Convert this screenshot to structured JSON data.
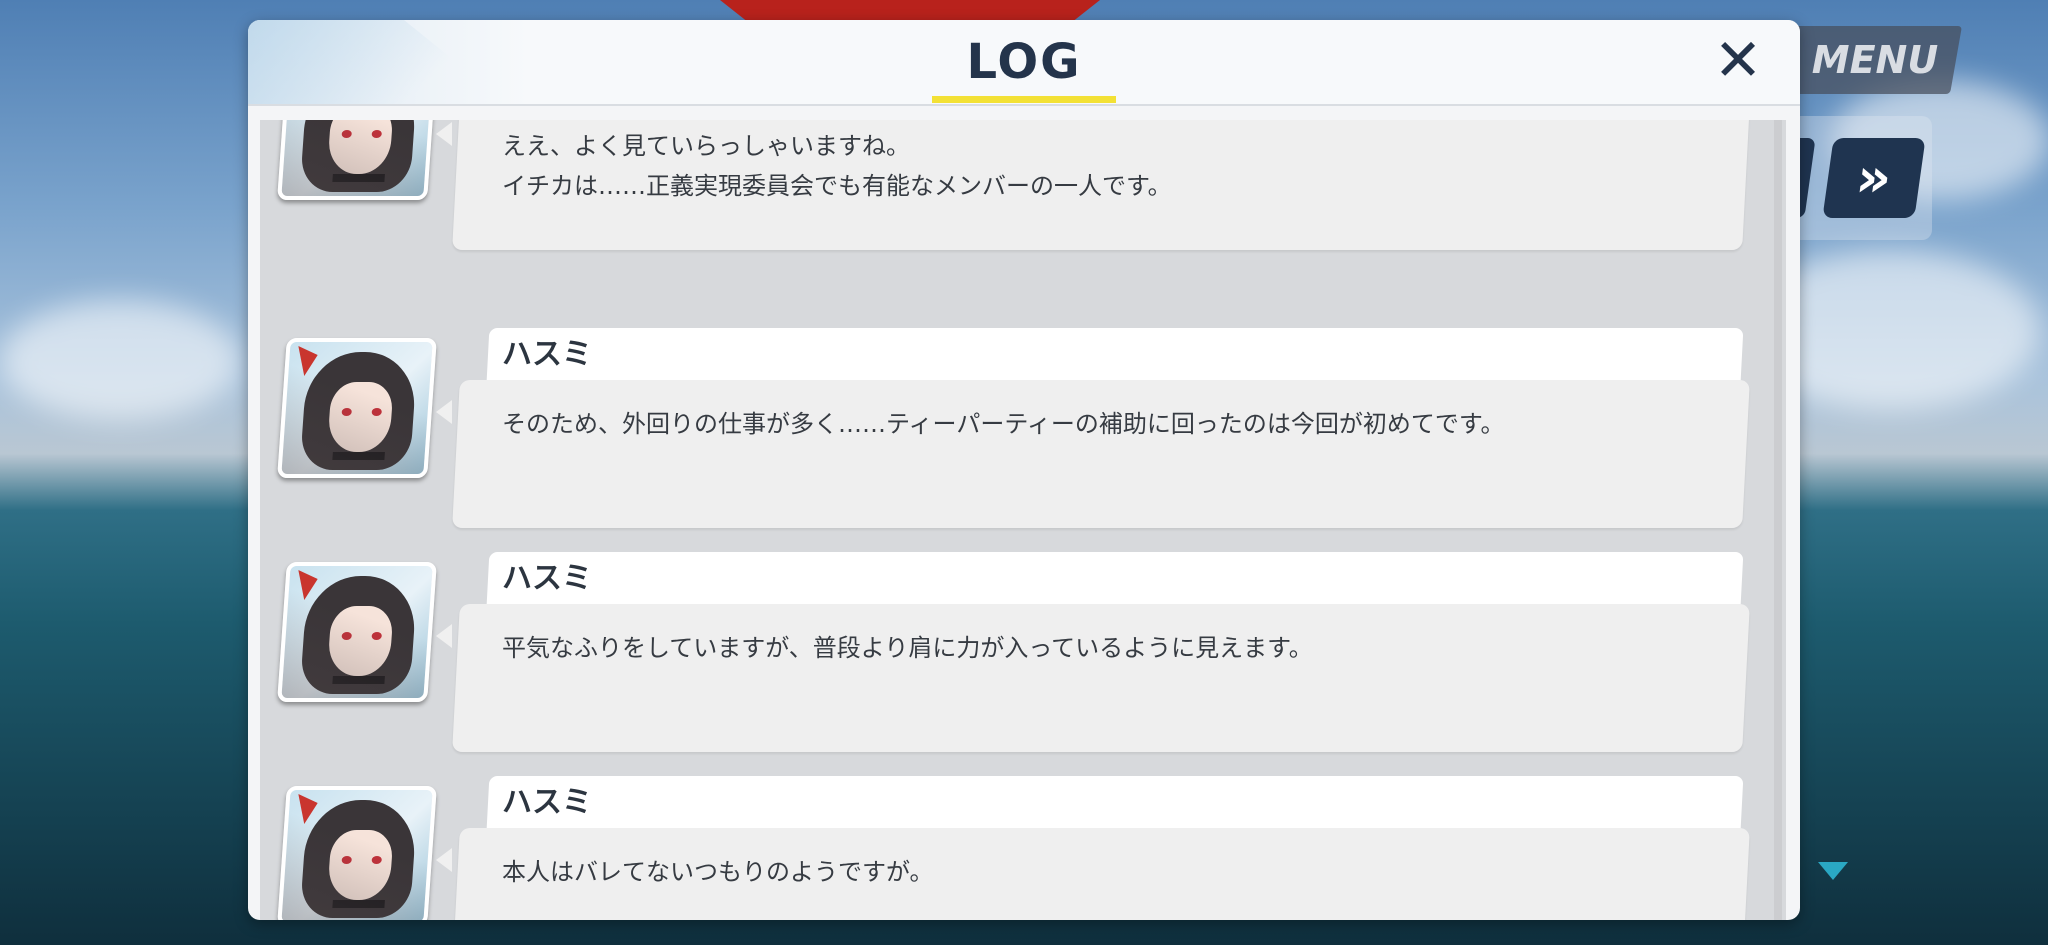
{
  "log": {
    "title": "LOG",
    "close_label": "✕",
    "entries": [
      {
        "speaker": "",
        "message": "ええ、よく見ていらっしゃいますね。\nイチカは……正義実現委員会でも有能なメンバーの一人です。"
      },
      {
        "speaker": "ハスミ",
        "message": "そのため、外回りの仕事が多く……ティーパーティーの補助に回ったのは今回が初めてです。"
      },
      {
        "speaker": "ハスミ",
        "message": "平気なふりをしていますが、普段より肩に力が入っているように見えます。"
      },
      {
        "speaker": "ハスミ",
        "message": "本人はバレてないつもりのようですが。"
      }
    ]
  },
  "hud": {
    "menu_label": "MENU",
    "fast_forward_label": "»",
    "scroll_down_icon": "triangle-down-icon"
  },
  "colors": {
    "title_accent": "#f3e135",
    "ff_button": "#1f3450",
    "scroll_arrow": "#2aa8c4"
  }
}
